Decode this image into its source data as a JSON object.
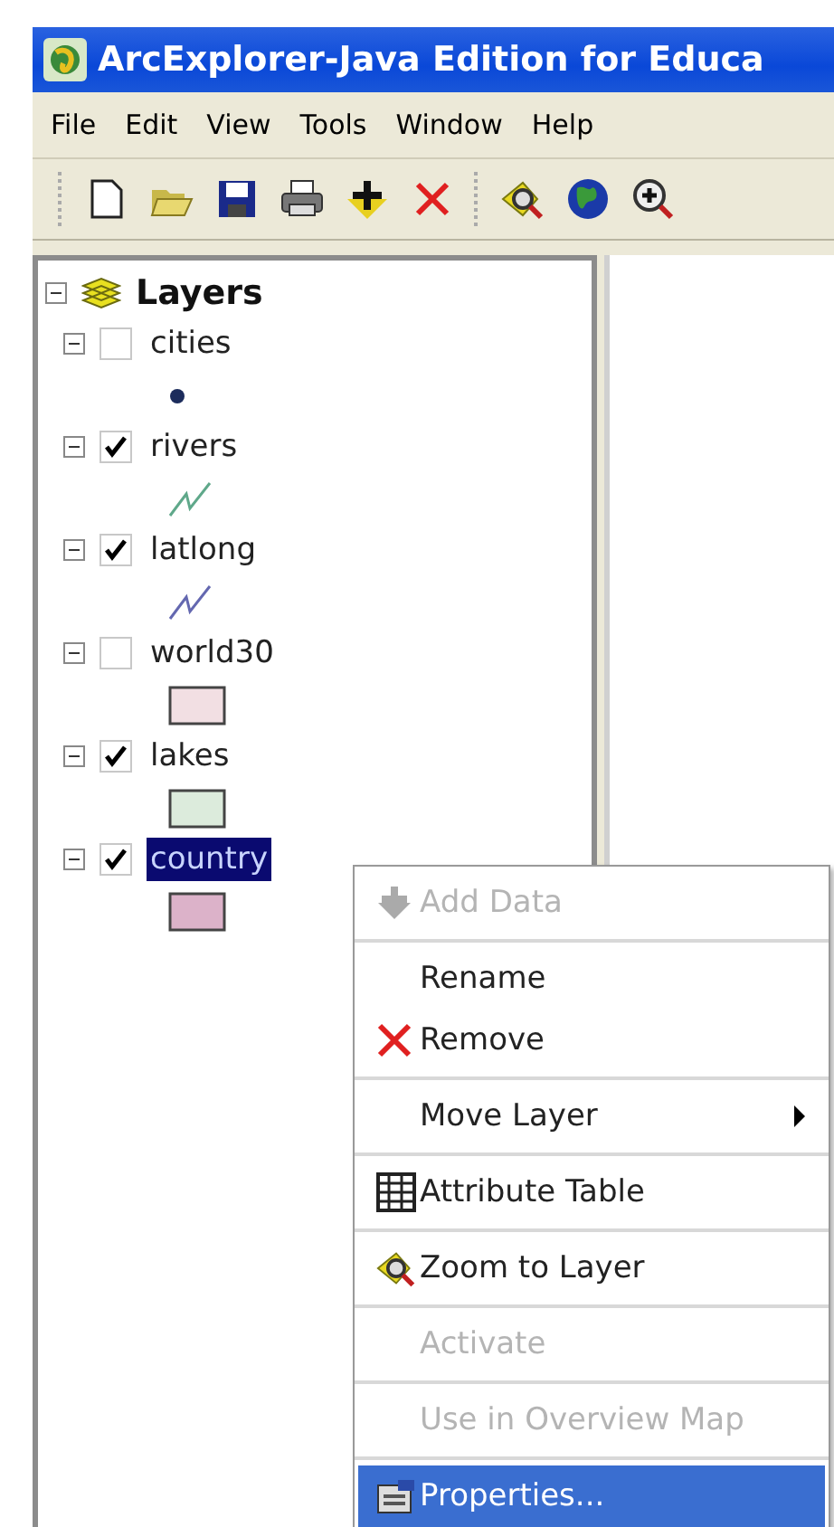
{
  "window": {
    "title": "ArcExplorer-Java Edition for Educa"
  },
  "menu_bar": [
    "File",
    "Edit",
    "View",
    "Tools",
    "Window",
    "Help"
  ],
  "toolbar": [
    {
      "kind": "new"
    },
    {
      "kind": "open"
    },
    {
      "kind": "save"
    },
    {
      "kind": "print"
    },
    {
      "kind": "add"
    },
    {
      "kind": "remove"
    },
    {
      "kind": "separator"
    },
    {
      "kind": "zoomlayer"
    },
    {
      "kind": "globe"
    },
    {
      "kind": "zoomin"
    }
  ],
  "tree": {
    "label": "Layers",
    "expanded": true,
    "layers": [
      {
        "name": "cities",
        "checked": false,
        "expanded": true,
        "selected": false,
        "symbol": {
          "kind": "point",
          "color": "#1c2c5c"
        }
      },
      {
        "name": "rivers",
        "checked": true,
        "expanded": true,
        "selected": false,
        "symbol": {
          "kind": "line",
          "color": "#5fa88a"
        }
      },
      {
        "name": "latlong",
        "checked": true,
        "expanded": true,
        "selected": false,
        "symbol": {
          "kind": "line",
          "color": "#6468b0"
        }
      },
      {
        "name": "world30",
        "checked": false,
        "expanded": true,
        "selected": false,
        "symbol": {
          "kind": "fill",
          "color": "#f2dfe3"
        }
      },
      {
        "name": "lakes",
        "checked": true,
        "expanded": true,
        "selected": false,
        "symbol": {
          "kind": "fill",
          "color": "#dcebdc"
        }
      },
      {
        "name": "country",
        "checked": true,
        "expanded": true,
        "selected": true,
        "symbol": {
          "kind": "fill",
          "color": "#dcb2c9"
        }
      }
    ]
  },
  "context_menu": [
    [
      {
        "label": "Add Data",
        "kind": "add",
        "disabled": true,
        "selected": false
      }
    ],
    [
      {
        "label": "Rename",
        "disabled": false,
        "selected": false
      },
      {
        "label": "Remove",
        "kind": "remove",
        "disabled": false,
        "selected": false
      }
    ],
    [
      {
        "label": "Move Layer",
        "submenu": true,
        "disabled": false,
        "selected": false
      }
    ],
    [
      {
        "label": "Attribute Table",
        "kind": "table",
        "disabled": false,
        "selected": false
      }
    ],
    [
      {
        "label": "Zoom to Layer",
        "kind": "zoomlayer",
        "disabled": false,
        "selected": false
      }
    ],
    [
      {
        "label": "Activate",
        "disabled": true,
        "selected": false
      }
    ],
    [
      {
        "label": "Use in Overview Map",
        "disabled": true,
        "selected": false
      }
    ],
    [
      {
        "label": "Properties...",
        "kind": "properties",
        "disabled": false,
        "selected": true
      }
    ]
  ]
}
